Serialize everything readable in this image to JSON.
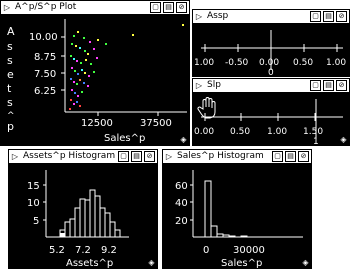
{
  "windows": {
    "plot": {
      "title": "A^p/S^p Plot",
      "y_axis_label": "Assets^p",
      "y_ticks": [
        "10.00",
        "8.75",
        "7.50",
        "6.25"
      ],
      "x_ticks": [
        "12500",
        "37500"
      ],
      "x_axis_label": "Sales^p"
    },
    "assp": {
      "title": "Assp",
      "ticks": [
        "1.00",
        "-0.50",
        "0.00",
        "0.50",
        "1.00"
      ],
      "value": "0"
    },
    "slp": {
      "title": "Slp",
      "ticks": [
        "0.00",
        "0.50",
        "1.00",
        "1.50"
      ],
      "value": "1"
    },
    "assets_hist": {
      "title": "Assets^p Histogram",
      "y_ticks": [
        "15",
        "10",
        "5"
      ],
      "x_ticks": [
        "5.2",
        "7.2",
        "9.2"
      ],
      "x_axis_label": "Assets^p"
    },
    "sales_hist": {
      "title": "Sales^p Histogram",
      "y_ticks": [
        "60",
        "40",
        "20"
      ],
      "x_ticks": [
        "0",
        "30000"
      ],
      "x_axis_label": "Sales^p"
    }
  },
  "icons": {
    "window_menu": "triangle-right-icon",
    "zoom": "zoom-box-icon",
    "page": "page-icon",
    "close": "circle-slash-icon",
    "resize": "diamond-resize-icon",
    "pan_hand": "hand-icon"
  },
  "colors": {
    "background": "#000000",
    "axis": "#ffffff",
    "titlebar": "#ffffff"
  }
}
